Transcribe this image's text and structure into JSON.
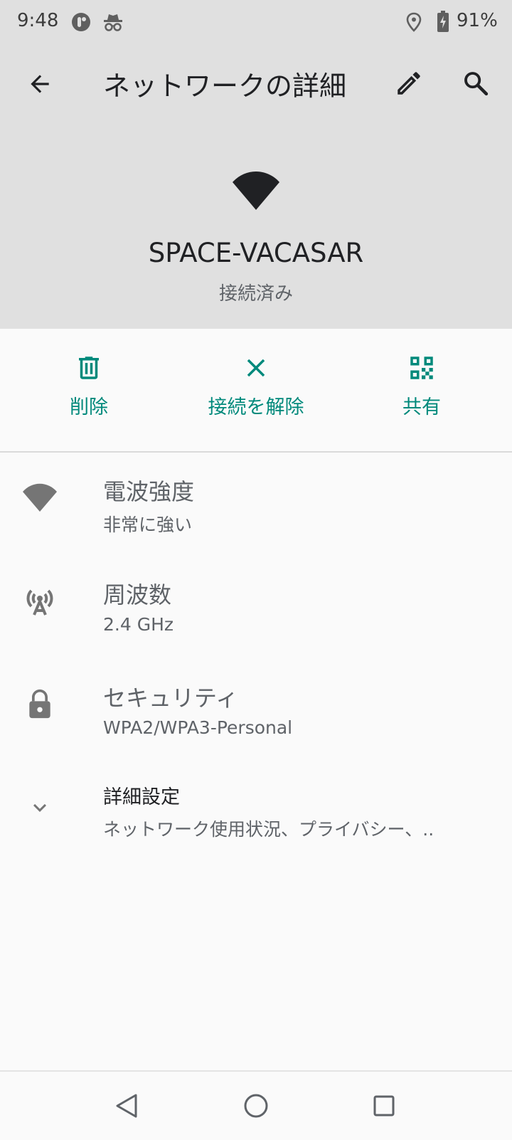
{
  "status_bar": {
    "time": "9:48",
    "battery": "91%",
    "icons": [
      "app-notification-icon",
      "incognito-icon",
      "location-icon",
      "battery-charging-icon"
    ]
  },
  "header": {
    "title": "ネットワークの詳細",
    "network_name": "SPACE-VACASAR",
    "network_status": "接続済み",
    "icons": [
      "back-arrow-icon",
      "pencil-icon",
      "search-icon",
      "wifi-full-icon"
    ]
  },
  "actions": [
    {
      "label": "削除",
      "icon": "trash-icon"
    },
    {
      "label": "接続を解除",
      "icon": "close-icon"
    },
    {
      "label": "共有",
      "icon": "qr-code-icon"
    }
  ],
  "details": [
    {
      "title": "電波強度",
      "value": "非常に強い",
      "icon": "wifi-signal-icon"
    },
    {
      "title": "周波数",
      "value": "2.4 GHz",
      "icon": "antenna-icon"
    },
    {
      "title": "セキュリティ",
      "value": "WPA2/WPA3-Personal",
      "icon": "lock-icon"
    },
    {
      "title": "詳細設定",
      "value": "ネットワーク使用状況、プライバシー、..",
      "icon": "chevron-down-icon"
    }
  ],
  "nav_bar": {
    "icons": [
      "triangle-back-icon",
      "circle-home-icon",
      "square-recents-icon"
    ]
  },
  "colors": {
    "header_bg": "#e0e0e0",
    "page_bg": "#fafafa",
    "accent": "#00897b",
    "secondary_text": "#5f6368"
  }
}
